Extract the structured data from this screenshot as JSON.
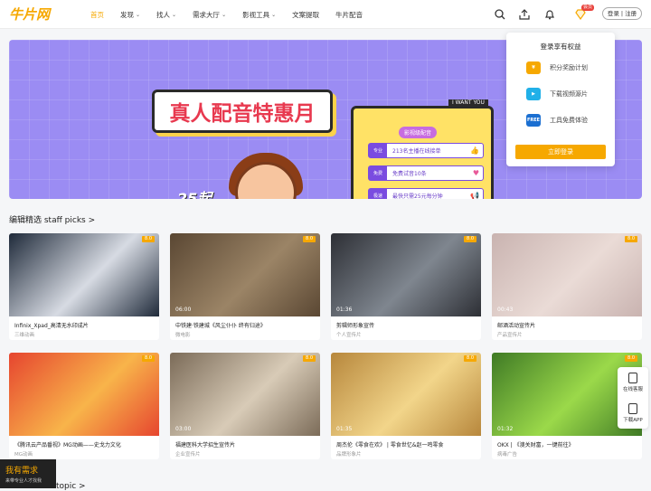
{
  "header": {
    "logo": "牛片网",
    "nav": [
      {
        "label": "首页",
        "active": true,
        "dropdown": false
      },
      {
        "label": "发现",
        "active": false,
        "dropdown": true
      },
      {
        "label": "找人",
        "active": false,
        "dropdown": true
      },
      {
        "label": "需求大厅",
        "active": false,
        "dropdown": true
      },
      {
        "label": "影视工具",
        "active": false,
        "dropdown": true
      },
      {
        "label": "文案提取",
        "active": false,
        "dropdown": false
      },
      {
        "label": "牛片配音",
        "active": false,
        "dropdown": false
      }
    ],
    "vip_badge": "会员",
    "login_label": "登录 | 注册",
    "icons": [
      "search-icon",
      "upload-icon",
      "bell-icon",
      "vip-diamond-icon"
    ]
  },
  "banner": {
    "title": "真人配音特惠月",
    "price": "25起",
    "board_head": "I WANT YOU",
    "board_sub": "影视级配音",
    "rows": [
      {
        "tag": "专业",
        "text": "213名主播在线接单",
        "icon": "thumb-up-icon"
      },
      {
        "tag": "免费",
        "text": "免费试音10条",
        "icon": "heart-icon"
      },
      {
        "tag": "极速",
        "text": "最快只需25元每分钟",
        "icon": "megaphone-icon"
      }
    ],
    "slides_count": 6,
    "active_slide": 0
  },
  "login_popup": {
    "title": "登录享有权益",
    "perks": [
      {
        "label": "积分奖励计划",
        "icon": "coin-icon",
        "color": "#f6a800",
        "glyph": "¥"
      },
      {
        "label": "下载视频源片",
        "icon": "download-video-icon",
        "color": "#21b0e8",
        "glyph": "▶"
      },
      {
        "label": "工具免费体验",
        "icon": "free-tool-icon",
        "color": "#1b6fd1",
        "glyph": "FREE"
      }
    ],
    "button": "立即登录"
  },
  "section_title": "编辑精选 staff picks >",
  "cards": [
    {
      "title": "Infinix_Xpad_高清无水印成片",
      "sub": "三维动画",
      "badge": "8.0",
      "duration": "",
      "thumb_color": "#1f2a3a",
      "thumb_accent": "#d7dbe3"
    },
    {
      "title": "中铁建·铁建城《风尘仆仆 终有归途》",
      "sub": "微电影",
      "badge": "8.0",
      "duration": "06:00",
      "thumb_color": "#5a4733",
      "thumb_accent": "#9b8466"
    },
    {
      "title": "剪辑师形象宣传",
      "sub": "个人宣传片",
      "badge": "8.0",
      "duration": "01:36",
      "thumb_color": "#2d2f35",
      "thumb_accent": "#7f868f"
    },
    {
      "title": "邮酒活动宣传片",
      "sub": "产品宣传片",
      "badge": "8.0",
      "duration": "00:43",
      "thumb_color": "#c9b3b0",
      "thumb_accent": "#eadbd6"
    },
    {
      "title": "《腾讯云产品番视》MG动画——史戈力文化",
      "sub": "MG动画",
      "badge": "8.0",
      "duration": "",
      "thumb_color": "#e6452f",
      "thumb_accent": "#f8b44a"
    },
    {
      "title": "福建医科大学招生宣传片",
      "sub": "企业宣传片",
      "badge": "8.0",
      "duration": "03:00",
      "thumb_color": "#7b6b58",
      "thumb_accent": "#d8cbb7"
    },
    {
      "title": "周杰伦《零食在欢》 | 零食世忆&赵一鸣零食",
      "sub": "品牌形象片",
      "badge": "8.0",
      "duration": "01:35",
      "thumb_color": "#b7873c",
      "thumb_accent": "#f2d58a"
    },
    {
      "title": "OKX | 《澳关财富，一键前往》",
      "sub": "病毒广告",
      "badge": "8.0",
      "duration": "01:32",
      "thumb_color": "#3f7a25",
      "thumb_accent": "#9bd94a"
    }
  ],
  "float_panel": [
    {
      "label": "在线客服",
      "icon": "chat-icon"
    },
    {
      "label": "下载APP",
      "icon": "phone-icon"
    }
  ],
  "recruit": {
    "main": "我有需求",
    "sub": "来带专业人才找我"
  },
  "section2_title": "topic >"
}
